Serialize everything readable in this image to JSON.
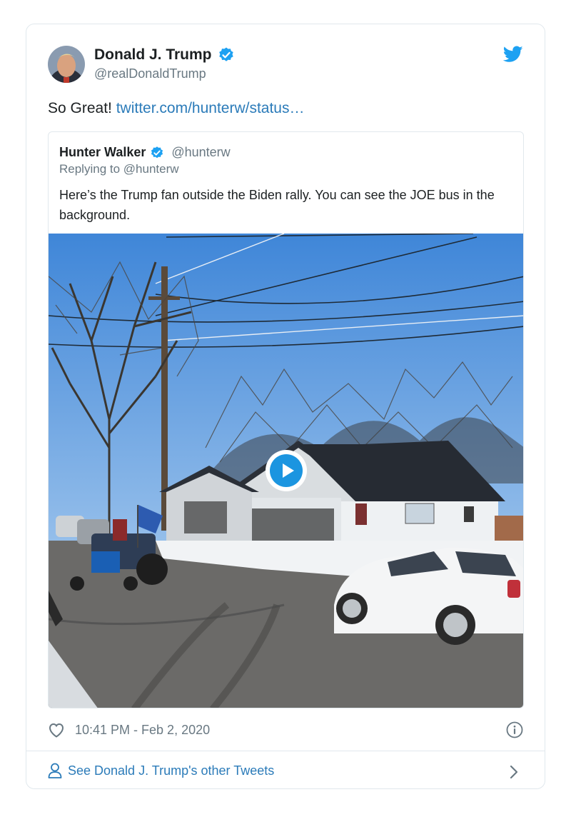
{
  "tweet": {
    "author_name": "Donald J. Trump",
    "author_handle": "@realDonaldTrump",
    "text_prefix": "So Great! ",
    "link_text": "twitter.com/hunterw/status…",
    "timestamp": "10:41 PM - Feb 2, 2020"
  },
  "quoted": {
    "author_name": "Hunter Walker",
    "author_handle": "@hunterw",
    "reply_to": "Replying to @hunterw",
    "text": "Here’s the Trump fan outside the Biden rally. You can see the JOE bus in the background."
  },
  "footer": {
    "link_label": "See Donald J. Trump's other Tweets"
  },
  "icons": {
    "logo": "twitter-bird-icon",
    "verified": "verified-badge-icon",
    "like": "heart-icon",
    "info": "info-icon",
    "profile": "person-icon",
    "next": "chevron-right-icon",
    "play": "play-icon"
  },
  "colors": {
    "accent": "#1da1f2",
    "link": "#2b7bb9",
    "secondary_text": "#697882",
    "border": "#e1e8ed"
  }
}
